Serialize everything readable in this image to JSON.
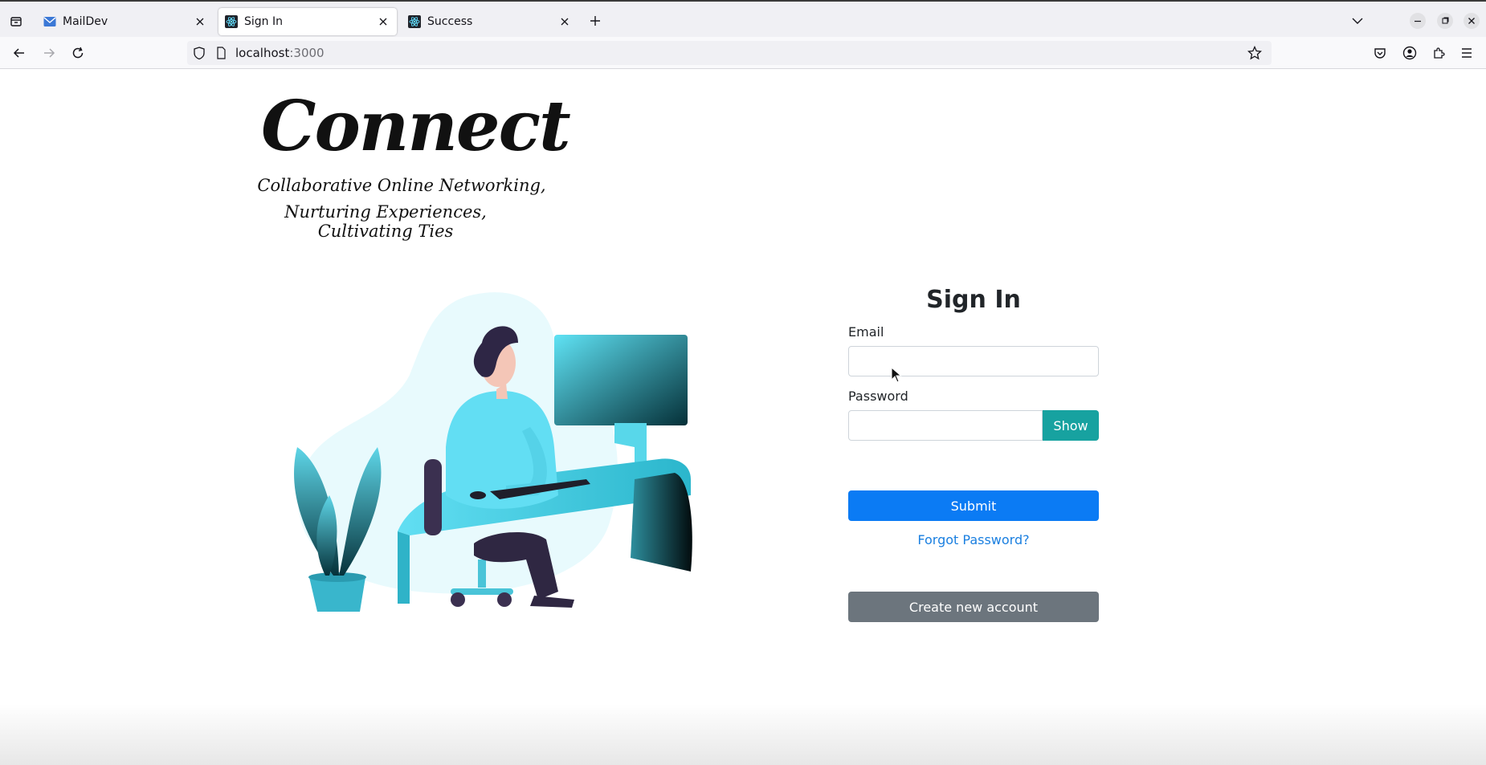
{
  "browser": {
    "tabs": [
      {
        "title": "MailDev",
        "icon": "mail-icon",
        "active": false
      },
      {
        "title": "Sign In",
        "icon": "react-icon",
        "active": true
      },
      {
        "title": "Success",
        "icon": "react-icon",
        "active": false
      }
    ],
    "url_host": "localhost",
    "url_port": ":3000"
  },
  "logo": {
    "main": "Connect",
    "tagline_line1": "Collaborative Online Networking,",
    "tagline_line2": "Nurturing Experiences, Cultivating Ties"
  },
  "form": {
    "title": "Sign In",
    "email_label": "Email",
    "email_value": "",
    "password_label": "Password",
    "password_value": "",
    "show_label": "Show",
    "submit_label": "Submit",
    "forgot_label": "Forgot Password?",
    "create_label": "Create new account"
  },
  "colors": {
    "submit": "#0b7bf4",
    "show": "#17a2a0",
    "create": "#6c757d",
    "link": "#1a7fe0"
  }
}
